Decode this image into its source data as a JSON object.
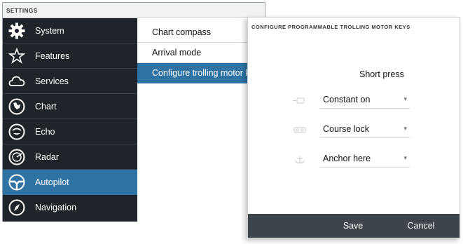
{
  "settings": {
    "title": "SETTINGS",
    "sidebar": [
      {
        "label": "System",
        "icon": "gear-icon"
      },
      {
        "label": "Features",
        "icon": "star-icon"
      },
      {
        "label": "Services",
        "icon": "cloud-icon"
      },
      {
        "label": "Chart",
        "icon": "chart-icon"
      },
      {
        "label": "Echo",
        "icon": "echo-icon"
      },
      {
        "label": "Radar",
        "icon": "radar-icon"
      },
      {
        "label": "Autopilot",
        "icon": "autopilot-wheel-icon"
      },
      {
        "label": "Navigation",
        "icon": "compass-icon"
      }
    ],
    "active_sidebar": "Autopilot",
    "list": [
      {
        "label": "Chart compass"
      },
      {
        "label": "Arrival mode"
      },
      {
        "label": "Configure trolling motor keys"
      }
    ],
    "active_list": "Configure trolling motor keys"
  },
  "dialog": {
    "title": "CONFIGURE PROGRAMMABLE TROLLING MOTOR KEYS",
    "column_header": "Short press",
    "keys": [
      {
        "key_icon": "constant-on-key-icon",
        "value": "Constant on"
      },
      {
        "key_icon": "course-lock-key-icon",
        "value": "Course lock"
      },
      {
        "key_icon": "anchor-key-icon",
        "value": "Anchor here"
      }
    ],
    "save_label": "Save",
    "cancel_label": "Cancel"
  },
  "colors": {
    "sidebar_bg": "#1f242b",
    "accent": "#2e73a3",
    "footer_bg": "#3e444b"
  }
}
